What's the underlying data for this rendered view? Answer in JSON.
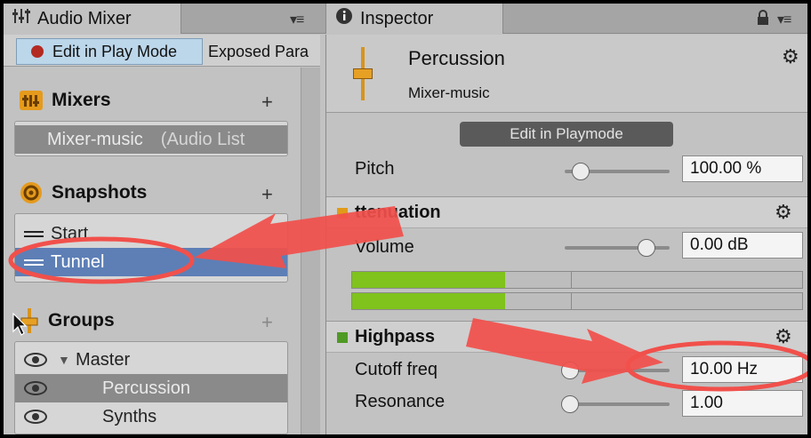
{
  "mixer_tab": {
    "title": "Audio Mixer"
  },
  "inspector_tab": {
    "title": "Inspector"
  },
  "toolbar": {
    "play_mode_label": "Edit in Play Mode",
    "exposed_label": "Exposed Para"
  },
  "mixers": {
    "title": "Mixers",
    "add": "+",
    "items": [
      {
        "name": "Mixer-music",
        "detail": "(Audio List"
      }
    ]
  },
  "snapshots": {
    "title": "Snapshots",
    "add": "+",
    "items": [
      {
        "name": "Start"
      },
      {
        "name": "Tunnel"
      }
    ]
  },
  "groups": {
    "title": "Groups",
    "add": "+",
    "items": [
      {
        "name": "Master"
      },
      {
        "name": "Percussion"
      },
      {
        "name": "Synths"
      }
    ]
  },
  "inspector": {
    "title": "Percussion",
    "subtitle": "Mixer-music",
    "playmode_button": "Edit in Playmode",
    "pitch": {
      "label": "Pitch",
      "value": "100.00 %",
      "level": 0.15
    },
    "attenuation": {
      "title": "Attenuation",
      "visible_title": "ttenuation",
      "volume_label": "Volume",
      "volume_value": "0.00 dB",
      "volume_level": 0.78,
      "meter_levels": [
        0.34,
        0.34
      ]
    },
    "highpass": {
      "title": "Highpass",
      "cutoff": {
        "label": "Cutoff freq",
        "value": "10.00 Hz",
        "level": 0.05
      },
      "resonance": {
        "label": "Resonance",
        "value": "1.00",
        "level": 0.05
      }
    }
  },
  "colors": {
    "selection": "#5d7fb6",
    "record": "#b32a22",
    "meter": "#7fc31c",
    "annotation": "#f1504b",
    "attenuation_square": "#e09b1a",
    "highpass_square": "#4f9a25"
  }
}
